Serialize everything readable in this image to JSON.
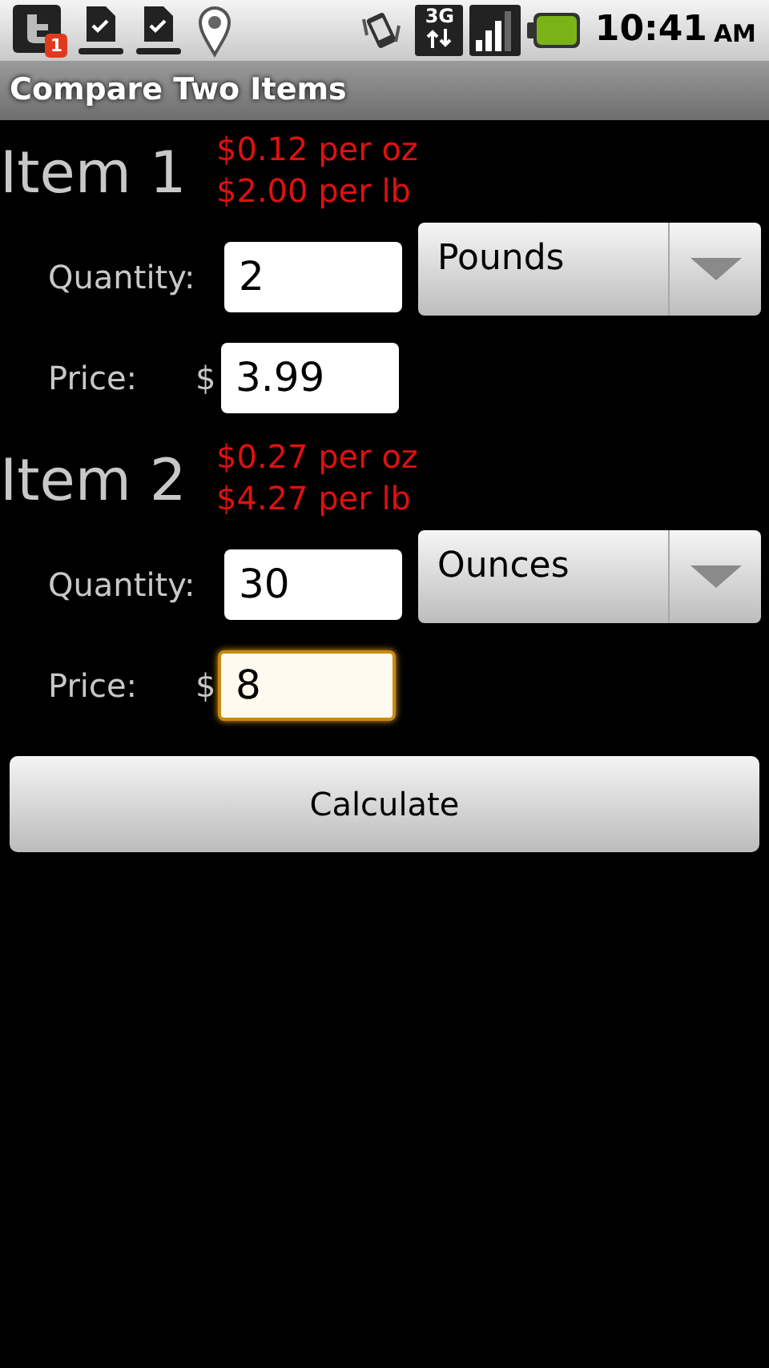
{
  "status_bar": {
    "notification_badge": "1",
    "network_type": "3G",
    "time": "10:41",
    "time_suffix": "AM"
  },
  "title_bar": {
    "title": "Compare Two Items"
  },
  "items": [
    {
      "title": "Item 1",
      "unit_prices": [
        "$0.12 per oz",
        "$2.00 per lb"
      ],
      "quantity_label": "Quantity:",
      "quantity": "2",
      "unit": "Pounds",
      "price_label": "Price:",
      "currency": "$",
      "price": "3.99",
      "price_focused": false
    },
    {
      "title": "Item 2",
      "unit_prices": [
        "$0.27 per oz",
        "$4.27 per lb"
      ],
      "quantity_label": "Quantity:",
      "quantity": "30",
      "unit": "Ounces",
      "price_label": "Price:",
      "currency": "$",
      "price": "8",
      "price_focused": true
    }
  ],
  "calculate_button": "Calculate"
}
